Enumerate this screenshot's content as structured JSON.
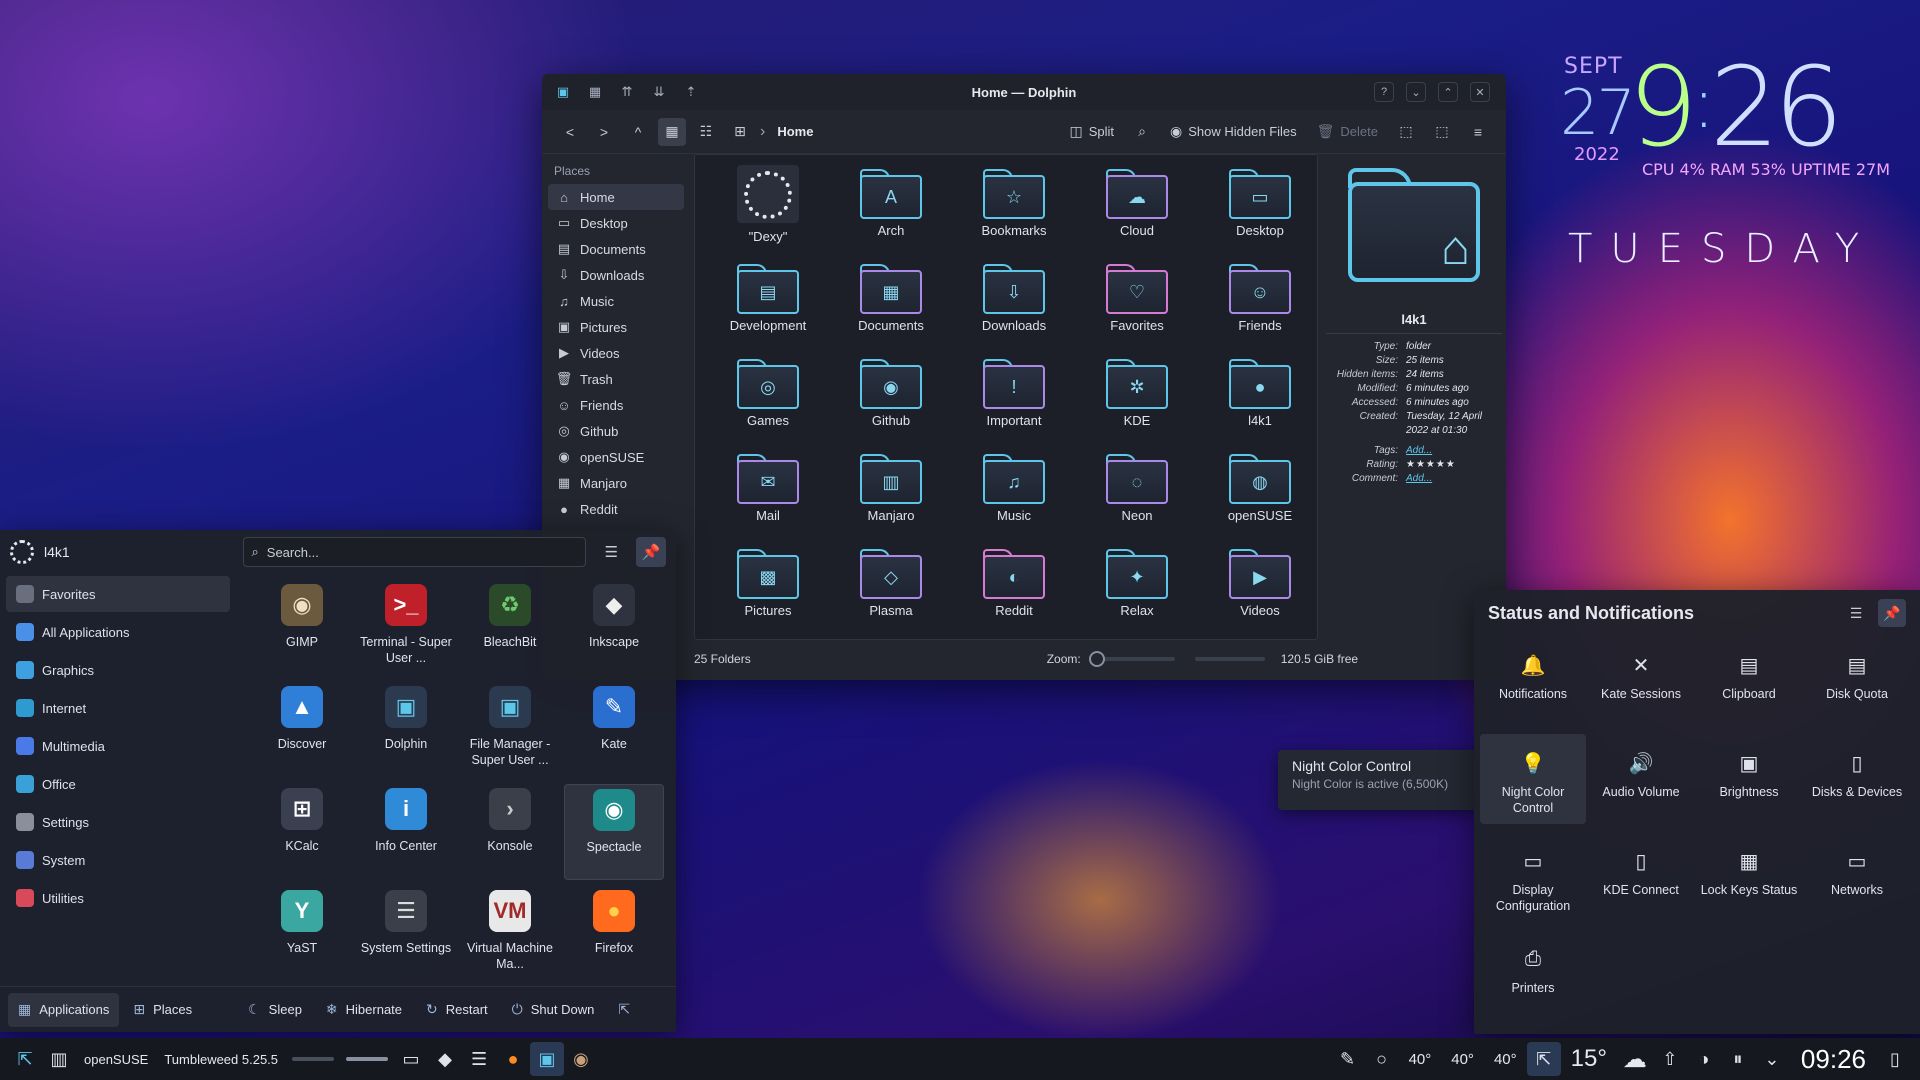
{
  "clock": {
    "month": "SEPT",
    "day": "27",
    "hour": "9",
    "minute": "26",
    "year": "2022",
    "stats": "CPU 4% RAM 53% UPTIME 27M",
    "weekday": "TUESDAY"
  },
  "dolphin": {
    "title": "Home — Dolphin",
    "breadcrumb": "Home",
    "toolbar": {
      "split": "Split",
      "hidden": "Show Hidden Files",
      "delete": "Delete"
    },
    "places_heading": "Places",
    "places": [
      "Home",
      "Desktop",
      "Documents",
      "Downloads",
      "Music",
      "Pictures",
      "Videos",
      "Trash",
      "Friends",
      "Github",
      "openSUSE",
      "Manjaro",
      "Reddit"
    ],
    "folders": [
      "\"Dexy\"",
      "Arch",
      "Bookmarks",
      "Cloud",
      "Desktop",
      "Development",
      "Documents",
      "Downloads",
      "Favorites",
      "Friends",
      "Games",
      "Github",
      "Important",
      "KDE",
      "l4k1",
      "Mail",
      "Manjaro",
      "Music",
      "Neon",
      "openSUSE",
      "Pictures",
      "Plasma",
      "Reddit",
      "Relax",
      "Videos"
    ],
    "info": {
      "name": "l4k1",
      "rows": [
        {
          "k": "Type:",
          "v": "folder"
        },
        {
          "k": "Size:",
          "v": "25 items"
        },
        {
          "k": "Hidden items:",
          "v": "24 items"
        },
        {
          "k": "Modified:",
          "v": "6 minutes ago"
        },
        {
          "k": "Accessed:",
          "v": "6 minutes ago"
        },
        {
          "k": "Created:",
          "v": "Tuesday, 12 April 2022 at 01:30"
        }
      ],
      "tags_label": "Tags:",
      "tags_value": "Add...",
      "rating_label": "Rating:",
      "rating_value": 0,
      "comment_label": "Comment:",
      "comment_value": "Add..."
    },
    "status": {
      "count": "25 Folders",
      "zoom_label": "Zoom:",
      "free": "120.5 GiB free"
    }
  },
  "launcher": {
    "user": "l4k1",
    "search_placeholder": "Search...",
    "categories": [
      "Favorites",
      "All Applications",
      "Graphics",
      "Internet",
      "Multimedia",
      "Office",
      "Settings",
      "System",
      "Utilities"
    ],
    "apps": [
      "GIMP",
      "Terminal - Super User ...",
      "BleachBit",
      "Inkscape",
      "Discover",
      "Dolphin",
      "File Manager - Super User ...",
      "Kate",
      "KCalc",
      "Info Center",
      "Konsole",
      "Spectacle",
      "YaST",
      "System Settings",
      "Virtual Machine Ma...",
      "Firefox"
    ],
    "footer": {
      "applications": "Applications",
      "places": "Places",
      "sleep": "Sleep",
      "hibernate": "Hibernate",
      "restart": "Restart",
      "shutdown": "Shut Down"
    }
  },
  "status_panel": {
    "title": "Status and Notifications",
    "items": [
      "Notifications",
      "Kate Sessions",
      "Clipboard",
      "Disk Quota",
      "Night Color Control",
      "Audio Volume",
      "Brightness",
      "Disks & Devices",
      "Display Configuration",
      "KDE Connect",
      "Lock Keys Status",
      "Networks",
      "Printers"
    ]
  },
  "tooltip": {
    "title": "Night Color Control",
    "subtitle": "Night Color is active (6,500K)"
  },
  "panel": {
    "distro": "openSUSE",
    "version": "Tumbleweed 5.25.5",
    "temps": [
      "40°",
      "40°",
      "40°"
    ],
    "weather": "15°",
    "time": "09:26"
  },
  "colors": {
    "accent": "#5ec6e8",
    "pink": "#d67ad4",
    "panel": "#16181f",
    "window": "#23262f"
  }
}
